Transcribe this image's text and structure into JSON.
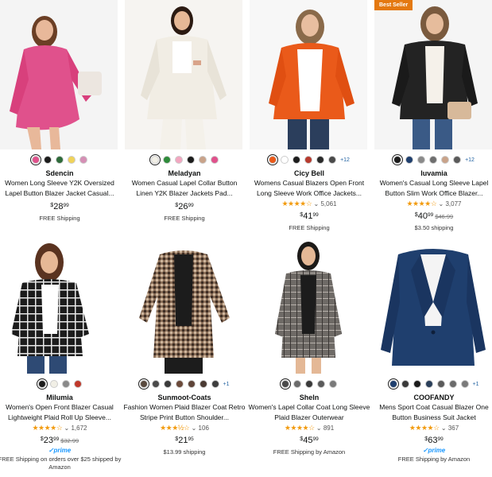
{
  "products": [
    {
      "brand": "Sdencin",
      "title": "Women Long Sleeve Y2K Oversized Lapel Button Blazer Jacket Casual...",
      "price_symbol": "$",
      "price_whole": "28",
      "price_fraction": "99",
      "shipping": "FREE Shipping",
      "swatches": [
        "#e0518c",
        "#1c1c1c",
        "#2e6b3a",
        "#f0d35a",
        "#d58fb5"
      ],
      "selected_swatch": 0,
      "image_desc": "pink-blazer"
    },
    {
      "brand": "Meladyan",
      "title": "Women Casual Lapel Collar Button Linen Y2K Blazer Jackets Pad...",
      "price_symbol": "$",
      "price_whole": "26",
      "price_fraction": "99",
      "shipping": "FREE Shipping",
      "swatches": [
        "#f1efe6",
        "#2e8b3a",
        "#f2a6c0",
        "#1c1c1c",
        "#c9a38a",
        "#e0518c"
      ],
      "selected_swatch": 0,
      "image_desc": "cream-blazer"
    },
    {
      "brand": "Cicy Bell",
      "title": "Womens Casual Blazers Open Front Long Sleeve Work Office Jackets...",
      "stars": "★★★★☆",
      "rating_count": "5,061",
      "price_symbol": "$",
      "price_whole": "41",
      "price_fraction": "99",
      "shipping": "FREE Shipping",
      "swatches": [
        "#ea5a1a",
        "#ffffff",
        "#1c1c1c",
        "#b73a2e",
        "#2a2a2a",
        "#4a4a4a"
      ],
      "more_colors": "+12",
      "selected_swatch": 0,
      "image_desc": "orange-blazer"
    },
    {
      "badge": "Best Seller",
      "brand": "luvamia",
      "title": "Women's Casual Long Sleeve Lapel Button Slim Work Office Blazer...",
      "stars": "★★★★☆",
      "rating_count": "3,077",
      "price_symbol": "$",
      "price_whole": "40",
      "price_fraction": "99",
      "list_price": "$46.99",
      "shipping": "$3.50 shipping",
      "swatches": [
        "#1c1c1c",
        "#1f3f6e",
        "#8a8a8a",
        "#6e6e6e",
        "#c9a38a",
        "#5a5a5a"
      ],
      "more_colors": "+12",
      "selected_swatch": 0,
      "image_desc": "black-blazer"
    },
    {
      "brand": "Milumia",
      "title": "Women's Open Front Blazer Casual Lightweight Plaid Roll Up Sleeve...",
      "stars": "★★★★☆",
      "rating_count": "1,672",
      "price_symbol": "$",
      "price_whole": "23",
      "price_fraction": "99",
      "list_price": "$32.99",
      "prime": "✓prime",
      "shipping": "FREE Shipping on orders over $25 shipped by Amazon",
      "swatches": [
        "#1c1c1c",
        "#f1efe6",
        "#8a8a8a",
        "#c0392b"
      ],
      "selected_swatch": 0,
      "image_desc": "black-plaid-blazer"
    },
    {
      "brand": "Sunmoot-Coats",
      "title": "Fashion Women Plaid Blazer Coat Retro Stripe Print Button Shoulder...",
      "stars": "★★★½☆",
      "rating_count": "106",
      "price_symbol": "$",
      "price_whole": "21",
      "price_fraction": "95",
      "shipping": "$13.99 shipping",
      "swatches": [
        "#5a4a3e",
        "#4a4a4a",
        "#3a3a3a",
        "#6b4a3a",
        "#5e4438",
        "#4a3a32",
        "#3e3e3e"
      ],
      "more_colors": "+1",
      "selected_swatch": 0,
      "image_desc": "houndstooth-blazer"
    },
    {
      "brand": "Sheln",
      "title": "Women's Lapel Collar Coat Long Sleeve Plaid Blazer Outerwear",
      "stars": "★★★★☆",
      "rating_count": "891",
      "price_symbol": "$",
      "price_whole": "45",
      "price_fraction": "99",
      "shipping": "FREE Shipping by Amazon",
      "swatches": [
        "#4a4a4a",
        "#6b6b6b",
        "#3a3a3a",
        "#5a5a5a",
        "#7a7a7a"
      ],
      "selected_swatch": 0,
      "image_desc": "grey-plaid-blazer"
    },
    {
      "brand": "COOFANDY",
      "title": "Mens Sport Coat Casual Blazer One Button Business Suit Jacket",
      "stars": "★★★★☆",
      "rating_count": "367",
      "price_symbol": "$",
      "price_whole": "63",
      "price_fraction": "99",
      "prime": "✓prime",
      "shipping": "FREE Shipping by Amazon",
      "swatches": [
        "#1f3f6e",
        "#3a3a3a",
        "#1c1c1c",
        "#2a3f5a",
        "#5a5a5a",
        "#6b6b6b",
        "#7a7a7a"
      ],
      "more_colors": "+1",
      "selected_swatch": 0,
      "image_desc": "navy-mens-blazer"
    }
  ]
}
